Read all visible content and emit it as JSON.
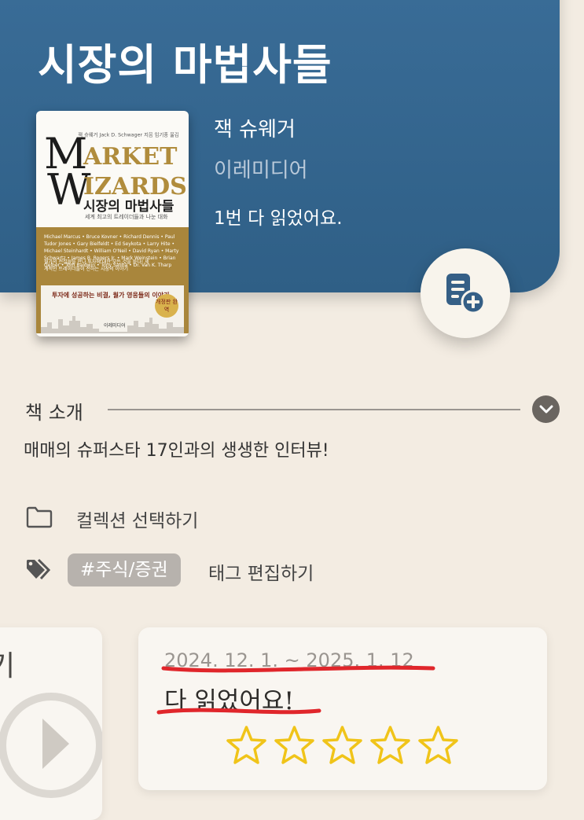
{
  "book": {
    "title": "시장의 마법사들",
    "author": "잭 슈웨거",
    "publisher": "이레미디어",
    "read_status": "1번 다 읽었어요."
  },
  "cover": {
    "top_text": "잭 슈웨거 Jack D. Schwager 지음 임기홍 옮김",
    "title_m": "M",
    "title_arket": "ARKET",
    "title_w": "W",
    "title_izards": "IZARDS",
    "title_kr": "시장의 마법사들",
    "subtitle_kr": "세계 최고의 트레이더들과 나눈 대화",
    "names": "Michael Marcus • Bruce Kovner • Richard Dennis • Paul Tudor Jones • Gary Bielfeldt • Ed Seykota • Larry Hite • Michael Steinhardt • William O'Neil • David Ryan • Marty Schwartz • James B. Rogers Jr. • Mark Weinstein • Brian Gelber • Tom Baldwin • Tony Saliba • Dr. Van K. Tharp",
    "blurb": "월가의 전설들을 만나 투자에 대한 모든 것을 듣다! 세계적인 트레이더들이 전하는 시장의 이야기",
    "tagline": "투자에 성공하는 비결, 월가 영웅들의 이야기",
    "seal": "개정판 완역",
    "publisher": "이레미디어"
  },
  "intro": {
    "label": "책 소개",
    "text": "매매의 슈퍼스타 17인과의 생생한 인터뷰!"
  },
  "collection": {
    "label": "컬렉션 선택하기"
  },
  "tags": {
    "chip": "#주식/증권",
    "edit_label": "태그 편집하기"
  },
  "reading_card": {
    "left_partial_text": "기",
    "dates": "2024. 12. 1. ~ 2025. 1. 12",
    "status": "다 읽었어요!",
    "rating": 0,
    "max_rating": 5
  },
  "colors": {
    "header": "#2f5f86",
    "background": "#f3ece2",
    "star": "#f0c419",
    "annotation": "#e0262b"
  },
  "icons": [
    "add-note-icon",
    "chevron-down-icon",
    "folder-icon",
    "tag-icon",
    "play-icon",
    "star-icon"
  ]
}
